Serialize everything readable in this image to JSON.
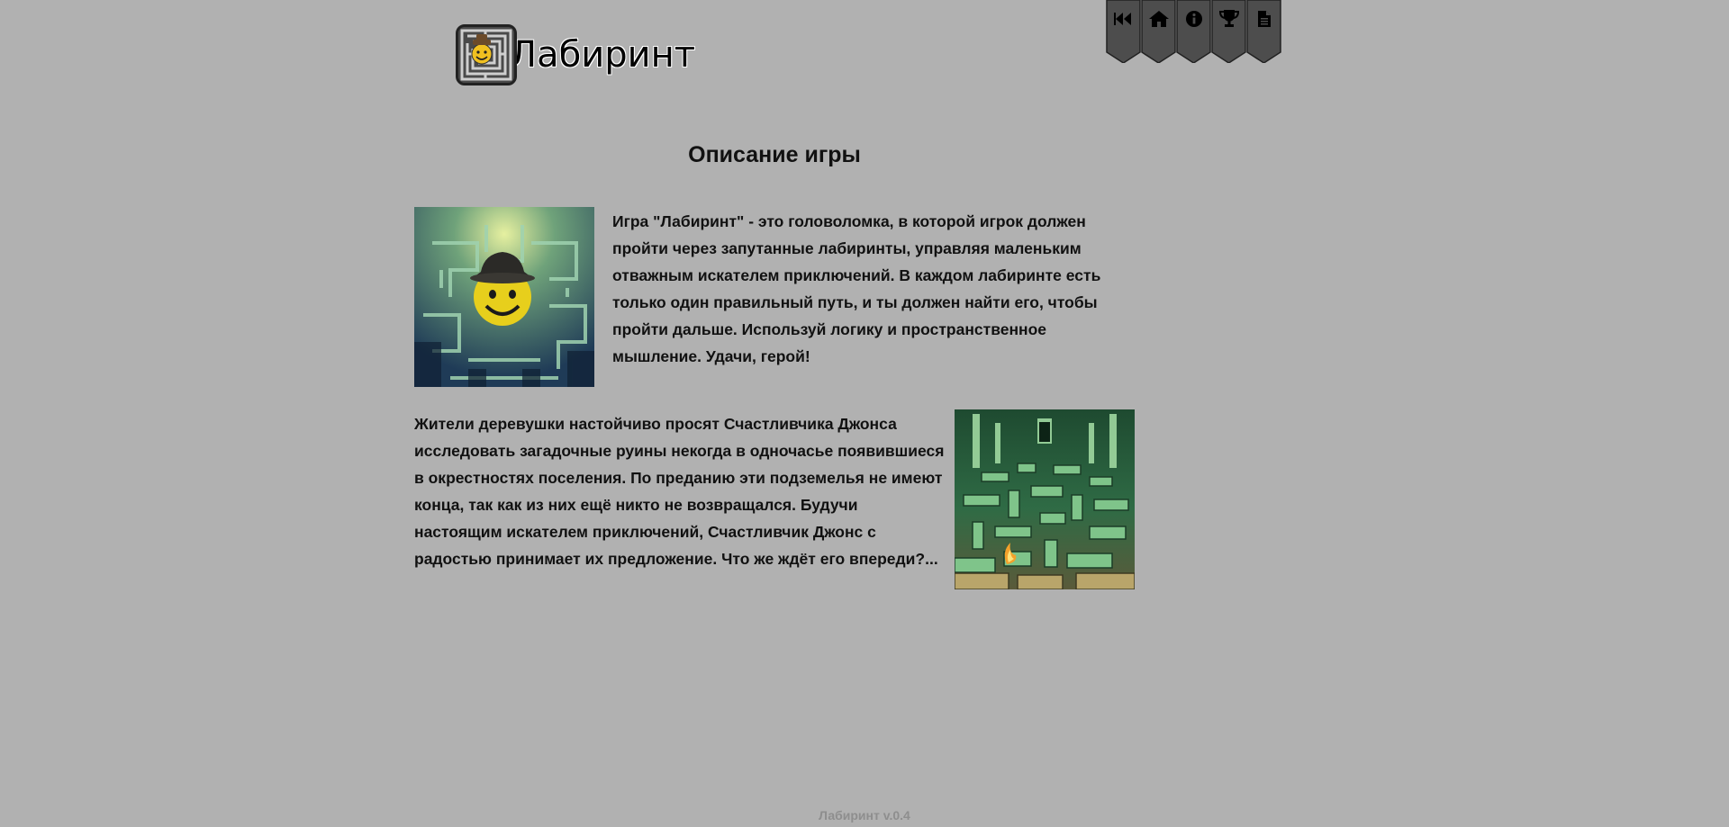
{
  "header": {
    "logo_icon": "maze-smiley-logo",
    "title": "Лабиринт"
  },
  "nav": {
    "items": [
      {
        "name": "back",
        "icon": "rewind-icon"
      },
      {
        "name": "home",
        "icon": "home-icon"
      },
      {
        "name": "info",
        "icon": "info-icon"
      },
      {
        "name": "trophy",
        "icon": "trophy-icon"
      },
      {
        "name": "document",
        "icon": "document-icon"
      }
    ]
  },
  "main": {
    "heading": "Описание игры",
    "paragraph1": "Игра \"Лабиринт\" - это головоломка, в которой игрок должен пройти через запутанные лабиринты, управляя маленьким отважным искателем приключений. В каждом лабиринте есть только один правильный путь, и ты должен найти его, чтобы пройти дальше. Используй логику и пространственное мышление. Удачи, герой!",
    "paragraph2": "Жители деревушки настойчиво просят Счастливчика Джонса исследовать загадочные руины некогда в одночасье появившиеся в окрестностях поселения. По преданию эти подземелья не имеют конца, так как из них ещё никто не возвращался. Будучи настоящим искателем приключений, Счастливчик Джонс с радостью принимает их предложение. Что же ждёт его впереди?..."
  },
  "footer": {
    "version": "Лабиринт v.0.4"
  },
  "colors": {
    "background": "#b1b1b1",
    "banner": "#4d4d4d",
    "footer_text": "#8e8e8e"
  }
}
